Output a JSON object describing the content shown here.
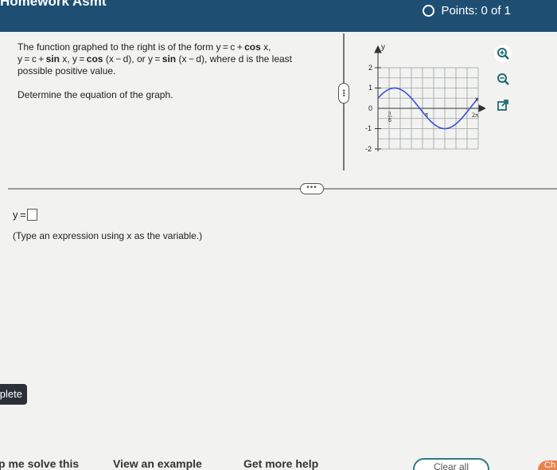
{
  "header": {
    "title": "Homework Asmt",
    "points_label": "Points: 0 of 1"
  },
  "question": {
    "line1_a": "The function graphed to the right is of the form y = c + ",
    "line1_b": "cos",
    "line1_c": " x,",
    "line2_a": "y = c + ",
    "line2_b": "sin",
    "line2_c": " x, y = ",
    "line2_d": "cos",
    "line2_e": " (x − d), or y = ",
    "line2_f": "sin",
    "line2_g": " (x − d), where d is the least",
    "line3": "possible positive value.",
    "instruction": "Determine the equation of the graph."
  },
  "answer": {
    "prefix": "y =",
    "hint": "(Type an expression using x as the variable.)"
  },
  "graph": {
    "y_axis_label": "y",
    "x_axis_label": "x",
    "y_ticks": [
      "2",
      "1",
      "0",
      "-1",
      "-2"
    ],
    "pi_over_6_num": "π",
    "pi_over_6_den": "6",
    "pi_label": "π",
    "two_pi_label": "2π",
    "curve_color": "#3a4fd6"
  },
  "tools": {
    "zoom_in": "zoom-in-icon",
    "zoom_out": "zoom-out-icon",
    "popout": "external-link-icon"
  },
  "buttons": {
    "complete": "plete",
    "help_solve": "p me solve this",
    "view_example": "View an example",
    "get_help": "Get more help",
    "clear_all": "Clear all",
    "check": "Ch"
  }
}
